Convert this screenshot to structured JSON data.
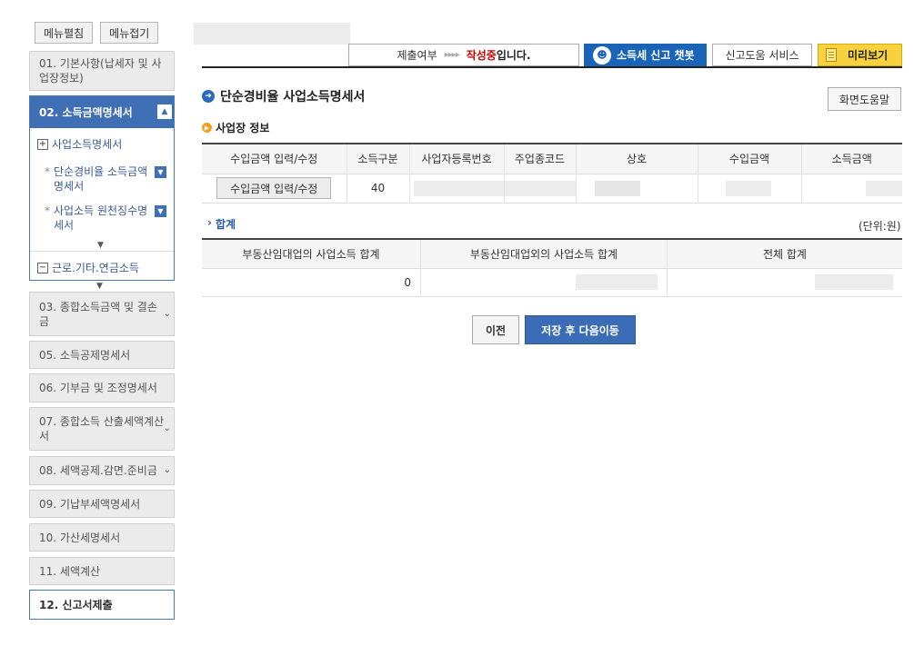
{
  "sidebar": {
    "expand_all_label": "메뉴펼침",
    "collapse_all_label": "메뉴접기",
    "item_01": "01. 기본사항(납세자 및 사업장정보)",
    "active_section": {
      "label": "02. 소득금액명세서",
      "sub_business": "사업소득명세서",
      "child_simple_rate": "단순경비율 소득금액명세서",
      "child_withholding": "사업소득 원천징수명세서",
      "sub_labor": "근로.기타.연금소득"
    },
    "item_03": "03. 종합소득금액 및 결손금",
    "item_05": "05. 소득공제명세서",
    "item_06": "06. 기부금 및 조정명세서",
    "item_07": "07. 종합소득 산출세액계산서",
    "item_08": "08. 세액공제.감면.준비금",
    "item_09": "09. 기납부세액명세서",
    "item_10": "10. 가산세명세서",
    "item_11": "11. 세액계산",
    "item_12": "12. 신고서제출"
  },
  "topbar": {
    "status_label": "제출여부",
    "status_arrows": "▸▸▸▸",
    "status_value": "작성중",
    "status_suffix": "입니다.",
    "chatbot_label": "소득세 신고 챗봇",
    "help_service_label": "신고도움 서비스",
    "preview_label": "미리보기"
  },
  "main": {
    "title": "단순경비율 사업소득명세서",
    "screen_help_label": "화면도움말",
    "section_title": "사업장 정보",
    "biz_table": {
      "headers": [
        "수입금액 입력/수정",
        "소득구분",
        "사업자등록번호",
        "주업종코드",
        "상호",
        "수입금액",
        "소득금액"
      ],
      "row": {
        "button_label": "수입금액 입력/수정",
        "income_type": "40"
      }
    },
    "total_title": "합계",
    "unit_label": "(단위:원)",
    "sum_table": {
      "headers": [
        "부동산임대업의 사업소득 합계",
        "부동산임대업외의 사업소득 합계",
        "전체 합계"
      ],
      "row": {
        "real_estate_total": "0"
      }
    },
    "prev_button": "이전",
    "save_next_button": "저장 후 다음이동"
  }
}
